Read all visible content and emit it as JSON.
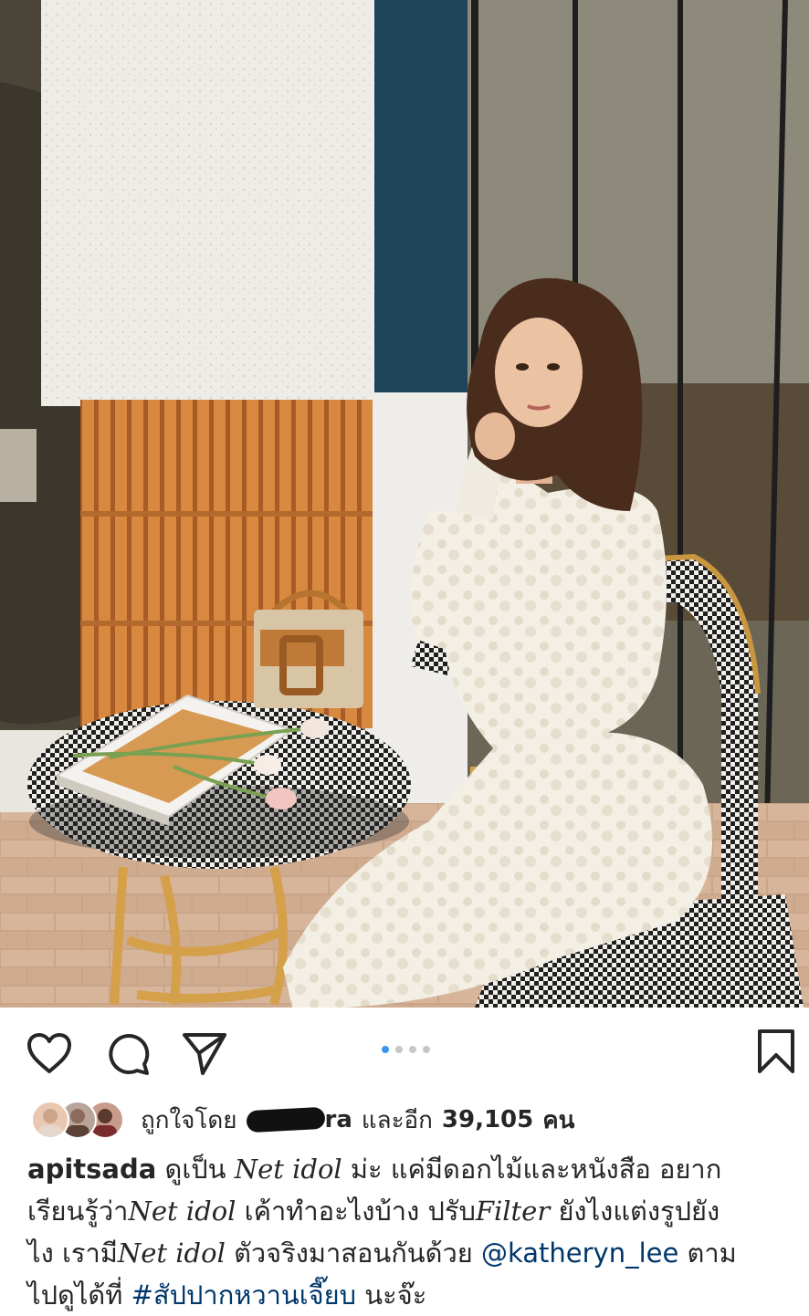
{
  "post": {
    "photo_alt": "photo",
    "pagination": {
      "total": 4,
      "active": 0
    }
  },
  "actions": {
    "like_icon": "heart-icon",
    "comment_icon": "comment-icon",
    "share_icon": "paper-plane-icon",
    "save_icon": "bookmark-icon"
  },
  "likes": {
    "prefix": "ถูกใจโดย",
    "name_visible_tail": "ra",
    "suffix": "และอีก",
    "count": "39,105",
    "unit": "คน"
  },
  "caption": {
    "username": "apitsada",
    "line1_a": "ดูเป็น",
    "line1_em": "Net idol",
    "line1_b": "ม่ะ แค่มีดอกไม้และหนังสือ อยาก",
    "line2_a": "เรียนรู้ว่า",
    "line2_em": "Net idol",
    "line2_b": "เค้าทำอะไงบ้าง ปรับ",
    "line2_em2": "Filter",
    "line2_c": "ยังไงแต่งรูปยัง",
    "line3_a": "ไง เรามี",
    "line3_em": "Net idol",
    "line3_b": "ตัวจริงมาสอนกันด้วย",
    "mention": "@katheryn_lee",
    "line3_c": "ตาม",
    "line4_a": "ไปดูได้ที่",
    "hashtag": "#สัปปากหวานเจี๊ยบ",
    "line4_b": "นะจ๊ะ"
  },
  "colors": {
    "link": "#00376b",
    "dot_active": "#3897f0",
    "dot_inactive": "#c7c7c7"
  }
}
